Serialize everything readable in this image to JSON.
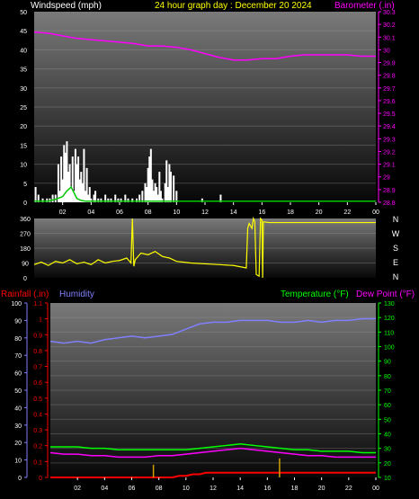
{
  "header": {
    "windspeed_label": "Windspeed (mph)",
    "title": "24 hour graph day : December 20 2024",
    "barometer_label": "Barometer (.in)"
  },
  "lower_header": {
    "rainfall_label": "Rainfall (.in)",
    "humidity_label": "Humidity",
    "temperature_label": "Temperature (°F)",
    "dewpoint_label": "Dew Point (°F)"
  },
  "colors": {
    "background": "#000000",
    "windspeed_gust": "#ffffff",
    "windspeed_avg": "#00c800",
    "barometer": "#ff00ff",
    "wind_direction": "#ffff00",
    "rainfall": "#ff0000",
    "humidity": "#8080ff",
    "temperature": "#00ff00",
    "dewpoint": "#ff00ff",
    "title": "#ffff00",
    "axis_text": "#ffffff"
  },
  "x_axis_ticks": [
    "02",
    "04",
    "06",
    "08",
    "10",
    "12",
    "14",
    "16",
    "18",
    "20",
    "22",
    "00"
  ],
  "direction_compass": [
    "N",
    "W",
    "S",
    "E",
    "N"
  ],
  "chart_data": [
    {
      "type": "bar",
      "panel": "wind",
      "xlim": [
        0,
        24
      ],
      "ylabel_left": "Windspeed (mph)",
      "ylim_left": [
        0,
        50
      ],
      "yticks_left": [
        0,
        5,
        10,
        15,
        20,
        25,
        30,
        35,
        40,
        45,
        50
      ],
      "ylabel_right": "Barometer (.in)",
      "ylim_right": [
        28.8,
        30.3
      ],
      "yticks_right": [
        "28.8",
        "28.9",
        "29",
        "29.1",
        "29.2",
        "29.3",
        "29.4",
        "29.5",
        "29.6",
        "29.7",
        "29.8",
        "29.9",
        "30",
        "30.1",
        "30.2",
        "30.3"
      ],
      "series": [
        {
          "name": "Windspeed (mph)",
          "kind": "gust-bars",
          "x": [
            0.1,
            0.3,
            0.6,
            0.9,
            1.1,
            1.3,
            1.5,
            1.7,
            1.8,
            1.9,
            2.0,
            2.1,
            2.2,
            2.3,
            2.4,
            2.5,
            2.6,
            2.7,
            2.8,
            2.9,
            3.0,
            3.1,
            3.2,
            3.3,
            3.4,
            3.5,
            3.6,
            3.7,
            3.8,
            3.9,
            4.0,
            4.2,
            4.3,
            4.5,
            4.7,
            5.0,
            5.2,
            5.4,
            5.7,
            5.9,
            6.1,
            6.4,
            6.6,
            6.9,
            7.2,
            7.4,
            7.6,
            7.8,
            7.9,
            8.0,
            8.1,
            8.2,
            8.3,
            8.4,
            8.5,
            8.6,
            8.7,
            8.8,
            8.9,
            9.0,
            9.2,
            9.3,
            9.4,
            9.5,
            9.6,
            9.8,
            10.0,
            11.8,
            13.1
          ],
          "values": [
            4,
            2,
            1,
            1,
            1,
            2,
            2,
            10,
            3,
            12,
            6,
            15,
            13,
            16,
            8,
            10,
            4,
            12,
            3,
            14,
            10,
            12,
            6,
            8,
            5,
            14,
            3,
            9,
            2,
            4,
            1,
            2,
            3,
            1,
            1,
            2,
            1,
            1,
            2,
            1,
            1,
            2,
            1,
            1,
            1,
            2,
            3,
            5,
            4,
            9,
            12,
            14,
            6,
            3,
            5,
            4,
            2,
            8,
            3,
            1,
            5,
            11,
            4,
            10,
            8,
            7,
            3,
            1,
            2
          ]
        },
        {
          "name": "Average windspeed",
          "kind": "line",
          "x": [
            0,
            1.0,
            1.5,
            2.0,
            2.3,
            2.6,
            2.8,
            3.0,
            3.3,
            3.6,
            4.0,
            24
          ],
          "values": [
            0.3,
            0.3,
            0.8,
            1.5,
            3.0,
            4.0,
            2.5,
            1.0,
            0.5,
            0.3,
            0.3,
            0.3
          ]
        },
        {
          "name": "Barometer (.in)",
          "kind": "line",
          "x": [
            0,
            1,
            2,
            3,
            4,
            5,
            6,
            7,
            8,
            9,
            10,
            11,
            12,
            13,
            14,
            15,
            16,
            17,
            18,
            19,
            20,
            21,
            22,
            23,
            24
          ],
          "values": [
            30.14,
            30.13,
            30.11,
            30.09,
            30.08,
            30.07,
            30.06,
            30.05,
            30.03,
            30.03,
            30.02,
            30.0,
            29.97,
            29.94,
            29.92,
            29.92,
            29.93,
            29.93,
            29.95,
            29.96,
            29.96,
            29.96,
            29.96,
            29.95,
            29.95
          ]
        }
      ]
    },
    {
      "type": "line",
      "panel": "direction",
      "xlim": [
        0,
        24
      ],
      "ylim": [
        0,
        360
      ],
      "yticks": [
        0,
        90,
        180,
        270,
        360
      ],
      "series": [
        {
          "name": "Wind direction",
          "x": [
            0,
            0.5,
            1,
            1.5,
            2,
            2.5,
            3,
            3.5,
            4,
            4.5,
            5,
            5.5,
            6,
            6.5,
            6.8,
            6.9,
            7.0,
            7.1,
            7.5,
            8,
            8.5,
            9,
            9.5,
            10,
            11,
            12,
            13,
            14,
            14.9,
            15.0,
            15.1,
            15.3,
            15.4,
            15.5,
            15.6,
            15.8,
            15.9,
            16.0,
            16.05,
            16.1,
            16.5,
            17,
            18,
            19,
            20,
            21,
            22,
            23,
            24
          ],
          "values": [
            80,
            95,
            75,
            100,
            90,
            110,
            85,
            95,
            80,
            110,
            90,
            100,
            105,
            120,
            90,
            360,
            70,
            110,
            150,
            140,
            160,
            130,
            120,
            100,
            90,
            85,
            80,
            75,
            60,
            300,
            330,
            300,
            360,
            340,
            20,
            10,
            360,
            350,
            0,
            340,
            335,
            335,
            335,
            335,
            335,
            335,
            335,
            335,
            335
          ]
        }
      ]
    },
    {
      "type": "line",
      "panel": "temperature",
      "xlim": [
        0,
        24
      ],
      "ylabel_left": "Humidity",
      "ylim_left": [
        0,
        100
      ],
      "yticks_left": [
        0,
        10,
        20,
        30,
        40,
        50,
        60,
        70,
        80,
        90,
        100
      ],
      "ylabel_left2": "Rainfall (.in)",
      "ylim_left2": [
        0,
        1.1
      ],
      "yticks_left2": [
        "0",
        "0.1",
        "0.2",
        "0.3",
        "0.4",
        "0.5",
        "0.6",
        "0.7",
        "0.8",
        "0.9",
        "1",
        "1.1"
      ],
      "ylabel_right": "Temperature (°F)",
      "ylim_right": [
        10,
        130
      ],
      "yticks_right": [
        10,
        20,
        30,
        40,
        50,
        60,
        70,
        80,
        90,
        100,
        110,
        120,
        130
      ],
      "series": [
        {
          "name": "Humidity",
          "x": [
            0,
            1,
            2,
            3,
            4,
            5,
            6,
            7,
            8,
            9,
            10,
            11,
            12,
            13,
            14,
            15,
            16,
            17,
            18,
            19,
            20,
            21,
            22,
            23,
            24
          ],
          "values": [
            78,
            77,
            78,
            77,
            79,
            80,
            81,
            80,
            81,
            82,
            85,
            88,
            89,
            89,
            90,
            90,
            90,
            89,
            89,
            90,
            89,
            90,
            90,
            91,
            91
          ]
        },
        {
          "name": "Temperature (°F)",
          "x": [
            0,
            1,
            2,
            3,
            4,
            5,
            6,
            7,
            8,
            9,
            10,
            11,
            12,
            13,
            14,
            15,
            16,
            17,
            18,
            19,
            20,
            21,
            22,
            23,
            24
          ],
          "values": [
            31,
            31,
            31,
            30,
            30,
            29,
            29,
            29,
            29,
            29,
            29,
            30,
            31,
            32,
            33,
            32,
            31,
            30,
            29,
            29,
            28,
            28,
            28,
            27,
            27
          ]
        },
        {
          "name": "Dew Point (°F)",
          "x": [
            0,
            1,
            2,
            3,
            4,
            5,
            6,
            7,
            8,
            9,
            10,
            11,
            12,
            13,
            14,
            15,
            16,
            17,
            18,
            19,
            20,
            21,
            22,
            23,
            24
          ],
          "values": [
            27,
            26,
            26,
            25,
            25,
            24,
            24,
            24,
            25,
            25,
            26,
            27,
            28,
            29,
            30,
            29,
            28,
            27,
            26,
            25,
            25,
            24,
            24,
            24,
            24
          ]
        },
        {
          "name": "Rainfall (.in)",
          "x": [
            0,
            9,
            9.5,
            10,
            10.5,
            11,
            11.5,
            12,
            24
          ],
          "values": [
            0,
            0,
            0.01,
            0.01,
            0.02,
            0.02,
            0.03,
            0.03,
            0.03
          ]
        },
        {
          "name": "Rain rate",
          "kind": "spikes",
          "x": [
            7.6,
            16.9
          ],
          "values": [
            0.08,
            0.12
          ]
        }
      ]
    }
  ]
}
